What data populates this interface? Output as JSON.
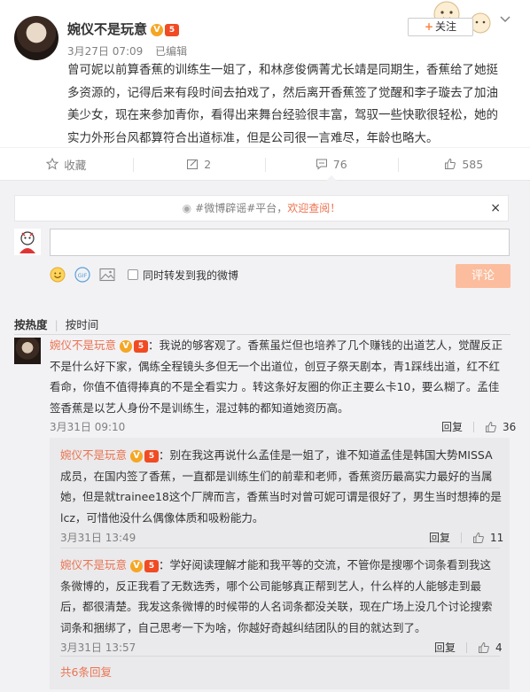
{
  "post": {
    "author": "婉仪不是玩意",
    "timestamp": "3月27日 07:09",
    "edited": "已编辑",
    "follow_label": "关注",
    "text": "曾可妮以前算香蕉的训练生一姐了，和林彦俊俩菁尤长靖是同期生，香蕉给了她挺多资源的，记得后来有段时间去拍戏了，然后离开香蕉签了觉醒和李子璇去了加油美少女，现在来参加青你，看得出来舞台经验很丰富，驾驭一些快歌很轻松，她的实力外形台风都算符合出道标准，但是公司很一言难尽，年龄也略大。",
    "badge_v": "V",
    "badge_level": "5"
  },
  "actions": {
    "favorite_label": "收藏",
    "repost_count": "2",
    "comment_count": "76",
    "like_count": "585"
  },
  "notice": {
    "hashtag": "#微博辟谣#",
    "text": "平台，",
    "link": "欢迎查阅！",
    "close": "×"
  },
  "composer": {
    "repost_option": "同时转发到我的微博",
    "submit_label": "评论"
  },
  "sort": {
    "hot": "按热度",
    "time": "按时间"
  },
  "comments": [
    {
      "user": "婉仪不是玩意",
      "text": "：我说的够客观了。香蕉虽烂但也培养了几个赚钱的出道艺人，觉醒反正不是什么好下家，偶练全程镜头多但无一个出道位，创豆子祭天剧本，青1踩线出道，红不红看命，你值不值得捧真的不是全看实力 。转这条好友圈的你正主要么卡10，要么糊了。孟佳签香蕉是以艺人身份不是训练生，混过韩的都知道她资历高。",
      "time": "3月31日 09:10",
      "reply_label": "回复",
      "likes": "36"
    }
  ],
  "replies": [
    {
      "user": "婉仪不是玩意",
      "text": "：别在我这再说什么孟佳是一姐了，谁不知道孟佳是韩国大势MISSA成员，在国内签了香蕉，一直都是训练生们的前辈和老师，香蕉资历最高实力最好的当属她，但是就trainee18这个厂牌而言，香蕉当时对曾可妮可谓是很好了，男生当时想捧的是lcz，可惜他没什么偶像体质和吸粉能力。",
      "time": "3月31日 13:49",
      "reply_label": "回复",
      "likes": "11"
    },
    {
      "user": "婉仪不是玩意",
      "text": "：学好阅读理解才能和我平等的交流，不管你是搜哪个词条看到我这条微博的，反正我看了无数选秀，哪个公司能够真正帮到艺人，什么样的人能够走到最后，都很清楚。我发这条微博的时候带的人名词条都没关联，现在广场上没几个讨论搜索词条和捆绑了，自己思考一下为啥，你越好奇越纠结团队的目的就达到了。",
      "time": "3月31日 13:57",
      "reply_label": "回复",
      "likes": "4"
    }
  ],
  "more_replies": "共6条回复",
  "colors": {
    "accent": "#eb7350",
    "submit_disabled": "#fbbd9e",
    "comment_bg": "#f2f2f5"
  }
}
